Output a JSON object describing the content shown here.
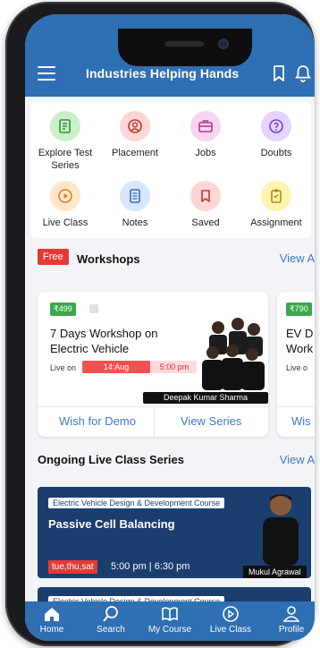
{
  "header": {
    "title": "Industries Helping Hands",
    "bg_color": "#2f6fb3"
  },
  "categories": [
    {
      "label": "Explore Test Series",
      "icon": "test-series-icon",
      "color": "#c8f0c8"
    },
    {
      "label": "Placement",
      "icon": "placement-icon",
      "color": "#ffd6d6"
    },
    {
      "label": "Jobs",
      "icon": "briefcase-icon",
      "color": "#f7d4ee"
    },
    {
      "label": "Doubts",
      "icon": "doubts-icon",
      "color": "#e6d3ff"
    },
    {
      "label": "Live Class",
      "icon": "live-class-icon",
      "color": "#ffe6c8"
    },
    {
      "label": "Notes",
      "icon": "notes-icon",
      "color": "#d6e6ff"
    },
    {
      "label": "Saved",
      "icon": "bookmark-icon",
      "color": "#ffd6d6"
    },
    {
      "label": "Assignment",
      "icon": "assignment-icon",
      "color": "#fff3b0"
    }
  ],
  "workshops": {
    "badge": "Free",
    "title": "Workshops",
    "view_all": "View All",
    "cards": [
      {
        "price": "₹499",
        "title": "7 Days Workshop on Electric Vehicle",
        "live_on": "Live on",
        "date": "14:Aug",
        "time": "5:00 pm",
        "instructor": "Deepak Kumar Sharma",
        "btn_demo": "Wish for Demo",
        "btn_series": "View Series"
      },
      {
        "price": "₹790",
        "title_partial": "EV D Work",
        "live_on_partial": "Live o",
        "btn_partial": "Wis"
      }
    ]
  },
  "live_series": {
    "title": "Ongoing Live Class Series",
    "view_all": "View All",
    "cards": [
      {
        "course": "Electric Vehicle Design & Development Course",
        "title": "Passive Cell Balancing",
        "days": "tue,thu,sat",
        "time": "5:00 pm | 6:30 pm",
        "tutor": "Mukul Agrawal"
      },
      {
        "course": "Electric Vehicle Design & Development Course"
      }
    ]
  },
  "bottom_nav": [
    {
      "label": "Home",
      "icon": "home-icon"
    },
    {
      "label": "Search",
      "icon": "search-icon"
    },
    {
      "label": "My Course",
      "icon": "book-icon"
    },
    {
      "label": "Live Class",
      "icon": "play-circle-icon"
    },
    {
      "label": "Profile",
      "icon": "profile-icon"
    }
  ]
}
